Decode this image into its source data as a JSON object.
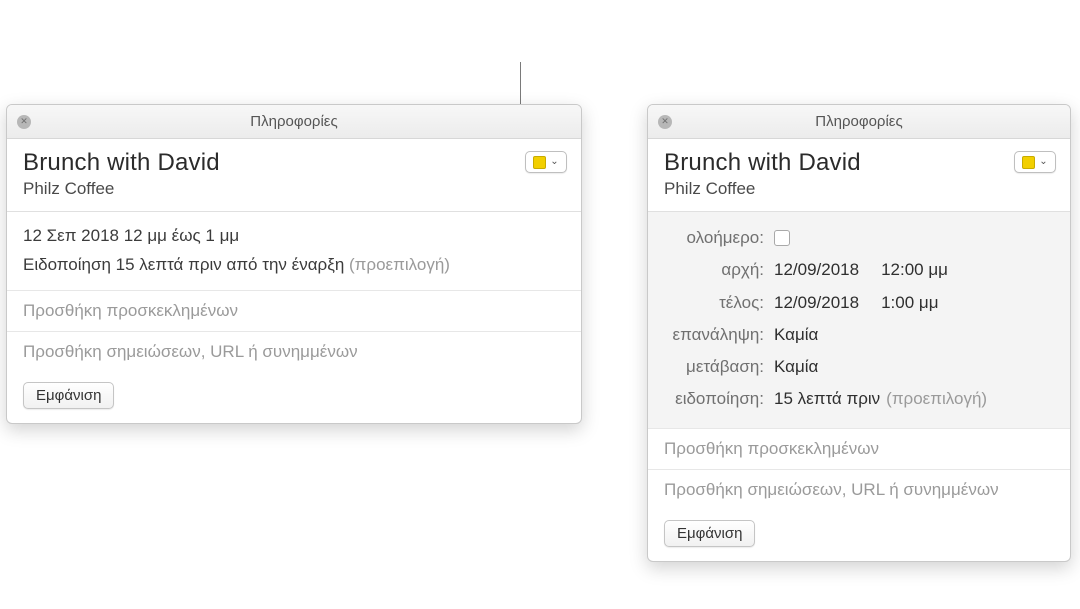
{
  "common": {
    "window_title": "Πληροφορίες",
    "event_title": "Brunch with David",
    "event_location": "Philz Coffee",
    "calendar_color": "#f2cf00",
    "show_button": "Εμφάνιση",
    "invitees_placeholder": "Προσθήκη προσκεκλημένων",
    "notes_placeholder": "Προσθήκη σημειώσεων, URL ή συνημμένων"
  },
  "left": {
    "time_line": "12 Σεπ 2018 12 μμ έως 1 μμ",
    "alert_prefix": "Ειδοποίηση 15 λεπτά πριν από την έναρξη",
    "alert_default": "(προεπιλογή)"
  },
  "right": {
    "labels": {
      "allday": "ολοήμερο:",
      "start": "αρχή:",
      "end": "τέλος:",
      "repeat": "επανάληψη:",
      "travel": "μετάβαση:",
      "alert": "ειδοποίηση:"
    },
    "values": {
      "allday_checked": false,
      "start_date": "12/09/2018",
      "start_time": "12:00 μμ",
      "end_date": "12/09/2018",
      "end_time": "1:00 μμ",
      "repeat": "Καμία",
      "travel": "Καμία",
      "alert": "15 λεπτά πριν",
      "alert_default": "(προεπιλογή)"
    }
  }
}
